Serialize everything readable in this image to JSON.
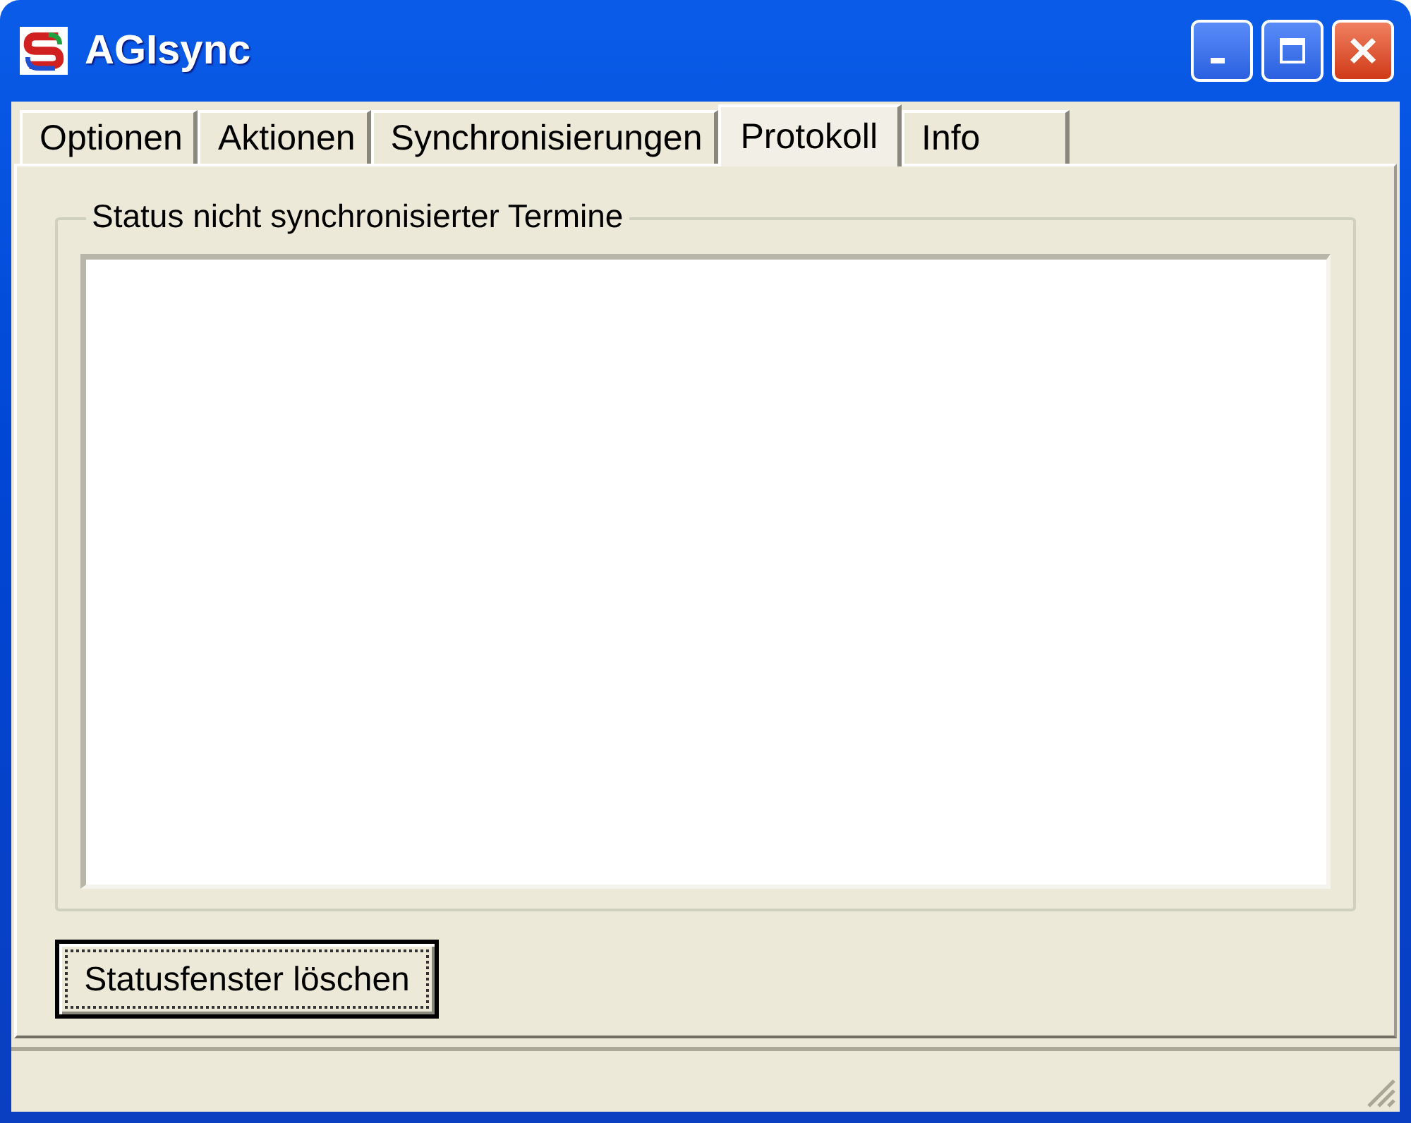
{
  "window": {
    "title": "AGIsync"
  },
  "tabs": [
    {
      "label": "Optionen",
      "selected": false
    },
    {
      "label": "Aktionen",
      "selected": false
    },
    {
      "label": "Synchronisierungen",
      "selected": false
    },
    {
      "label": "Protokoll",
      "selected": true
    },
    {
      "label": "Info",
      "selected": false
    }
  ],
  "group": {
    "title": "Status nicht synchronisierter Termine"
  },
  "button": {
    "label": "Statusfenster löschen",
    "focused": true
  }
}
